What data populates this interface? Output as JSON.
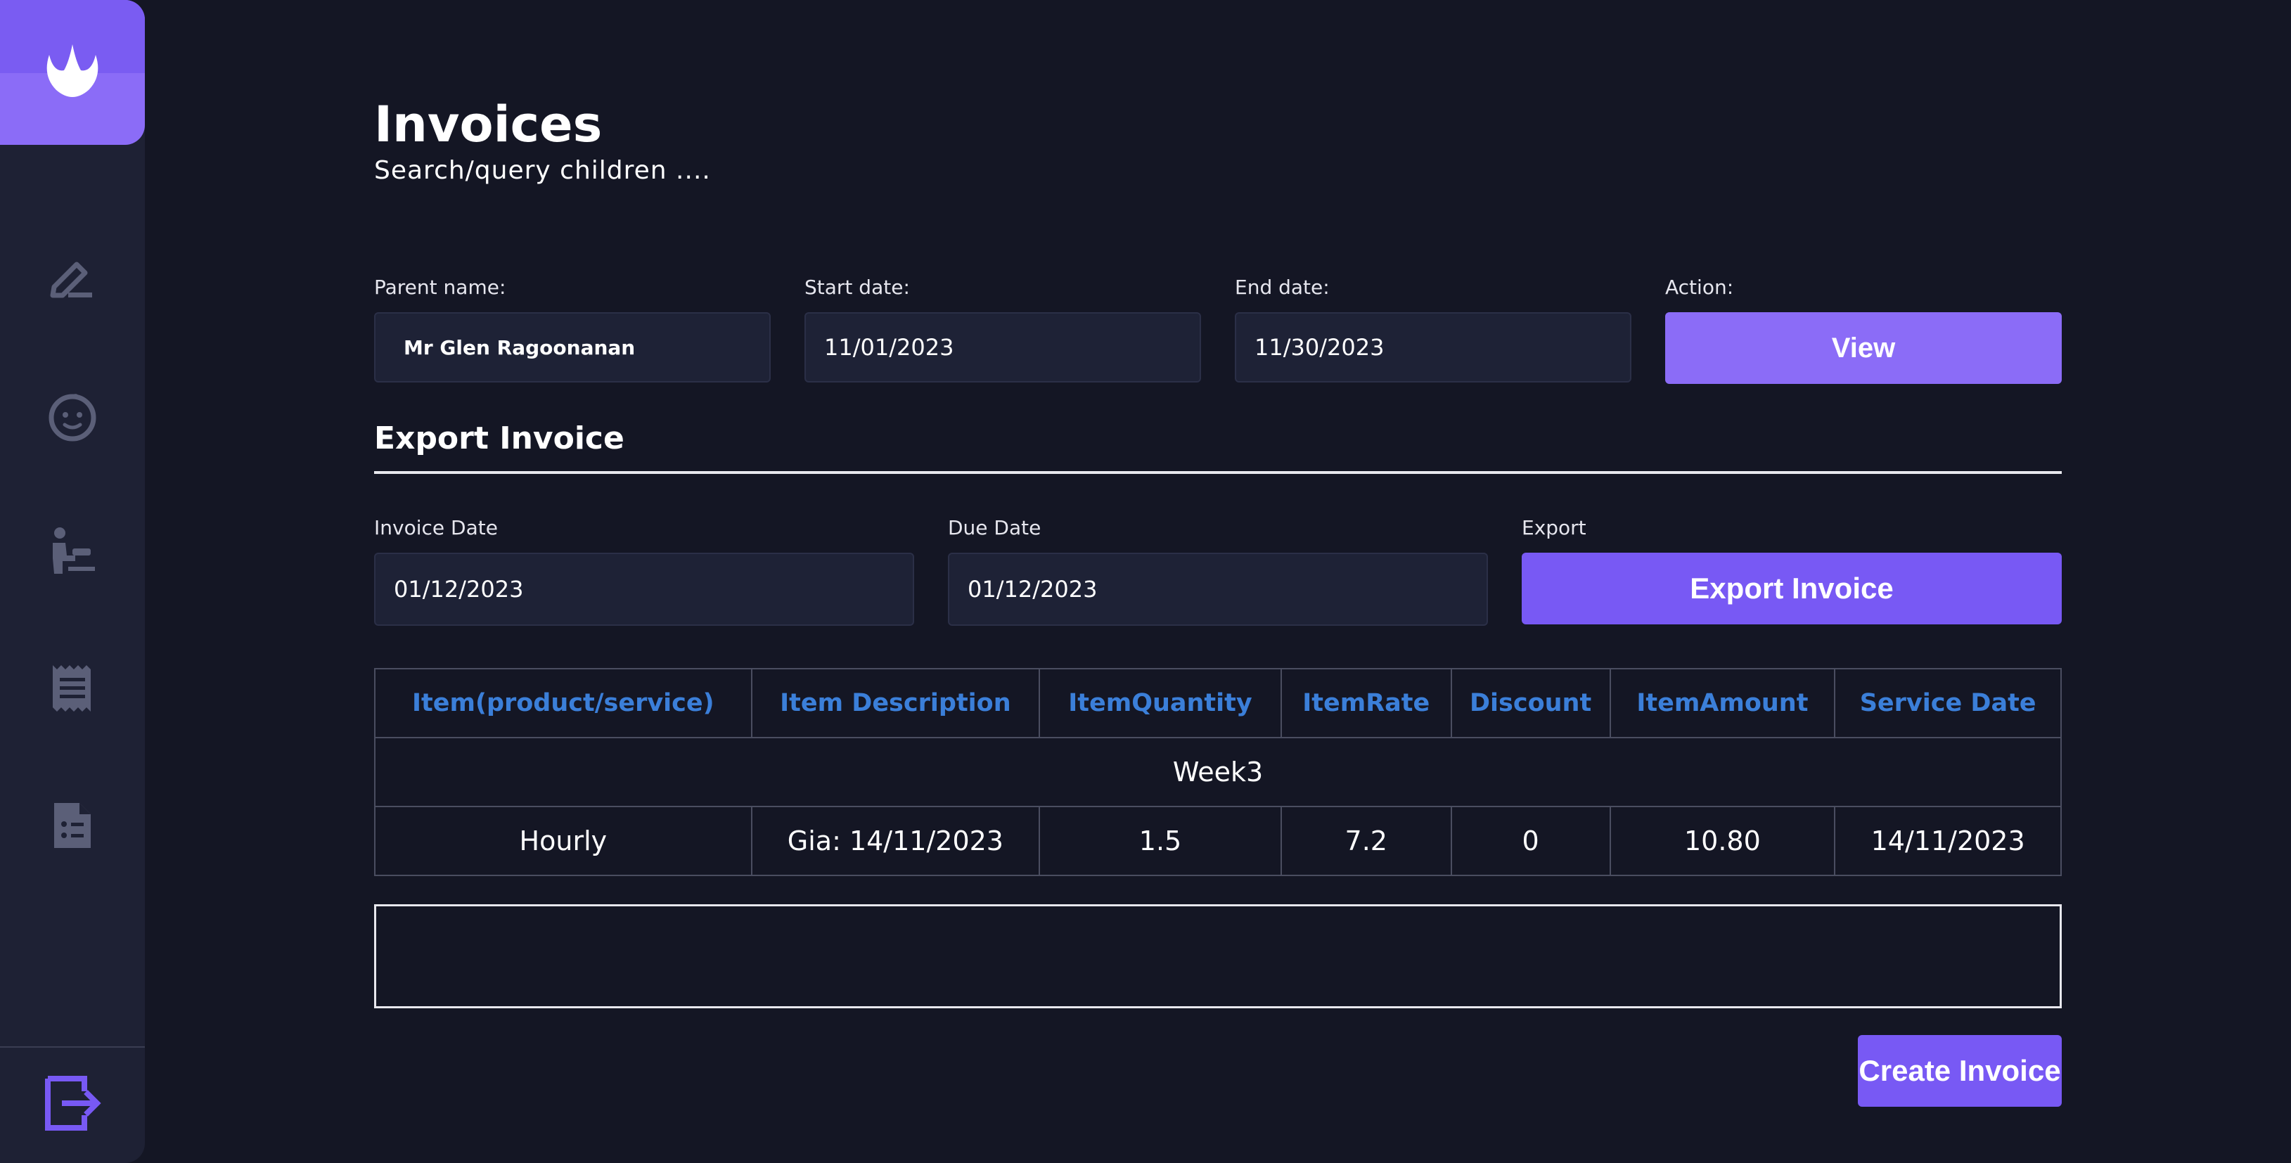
{
  "app": {
    "logo_icon": "leaf-logo-icon",
    "nav_icons": [
      "edit-icon",
      "child-face-icon",
      "caregiver-icon",
      "receipt-icon",
      "document-icon"
    ],
    "logout_icon": "logout-icon",
    "accent_color": "#7859f4",
    "header_color": "#3b7fd9"
  },
  "header": {
    "title": "Invoices",
    "subtitle": "Search/query children ...."
  },
  "filters": {
    "parent_label": "Parent name:",
    "parent_value": "Mr Glen Ragoonanan",
    "start_label": "Start date:",
    "start_value": "11/01/2023",
    "end_label": "End date:",
    "end_value": "11/30/2023",
    "action_label": "Action:",
    "view_button": "View"
  },
  "export": {
    "title": "Export Invoice",
    "invoice_date_label": "Invoice Date",
    "invoice_date_value": "01/12/2023",
    "due_date_label": "Due Date",
    "due_date_value": "01/12/2023",
    "export_label": "Export",
    "export_button": "Export Invoice"
  },
  "table": {
    "headers": [
      "Item(product/service)",
      "Item Description",
      "ItemQuantity",
      "ItemRate",
      "Discount",
      "ItemAmount",
      "Service Date"
    ],
    "group_label": "Week3",
    "rows": [
      [
        "Hourly",
        "Gia: 14/11/2023",
        "1.5",
        "7.2",
        "0",
        "10.80",
        "14/11/2023"
      ]
    ]
  },
  "notes": {
    "value": ""
  },
  "footer": {
    "create_button": "Create Invoice"
  }
}
